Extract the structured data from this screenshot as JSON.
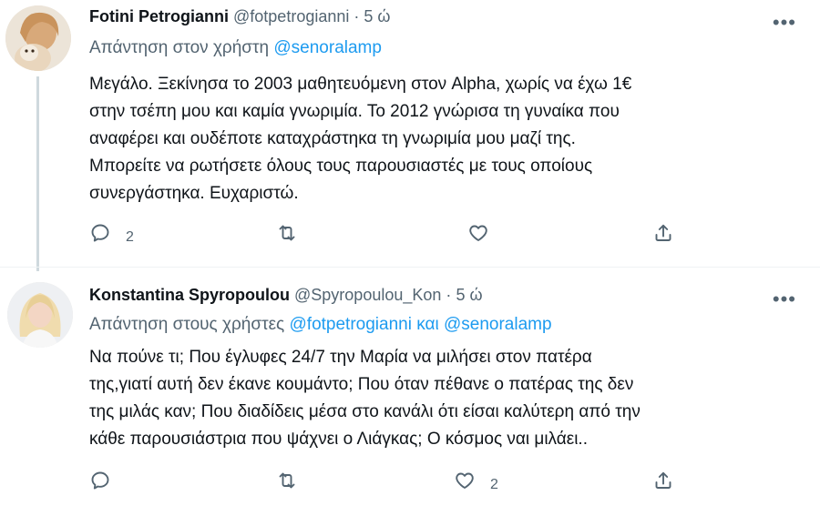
{
  "tweets": [
    {
      "name": "Fotini Petrogianni",
      "handle": "@fotpetrogianni",
      "dot": "·",
      "time": "5 ώ",
      "reply_prefix": "Απάντηση στον χρήστη",
      "mentions": [
        "@senoralamp"
      ],
      "mention_joiner": "",
      "body_lines": [
        "Μεγάλο. Ξεκίνησα το 2003 μαθητευόμενη στον Alpha, χωρίς να έχω 1€",
        "στην τσέπη μου και καμία γνωριμία. Το 2012 γνώρισα τη γυναίκα που",
        "αναφέρει και ουδέποτε καταχράστηκα τη γνωριμία μου μαζί της.",
        "Μπορείτε να ρωτήσετε όλους τους παρουσιαστές με τους οποίους",
        "συνεργάστηκα. Ευχαριστώ."
      ],
      "reply_count": "2",
      "retweet_count": "",
      "like_count": "",
      "more_icon": "more-icon"
    },
    {
      "name": "Konstantina Spyropoulou",
      "handle": "@Spyropoulou_Kon",
      "dot": "·",
      "time": "5 ώ",
      "reply_prefix": "Απάντηση στους χρήστες",
      "mentions": [
        "@fotpetrogianni",
        "@senoralamp"
      ],
      "mention_joiner": "και",
      "body_lines": [
        "Να πούνε τι; Που έγλυφες 24/7 την Μαρία να μιλήσει στον πατέρα",
        "της,γιατί αυτή δεν έκανε κουμάντο; Που όταν πέθανε ο πατέρας της δεν",
        "της μιλάς καν; Που διαδίδεις μέσα στο κανάλι ότι είσαι καλύτερη από την",
        "κάθε παρουσιάστρια που ψάχνει ο Λιάγκας; Ο κόσμος ναι μιλάει.."
      ],
      "reply_count": "",
      "retweet_count": "",
      "like_count": "2",
      "more_icon": "more-icon"
    }
  ],
  "colors": {
    "accent": "#1d9bf0",
    "secondary_text": "#536471",
    "primary_text": "#0f1419",
    "thread_line": "#cfd9de"
  },
  "icons": [
    "reply-icon",
    "retweet-icon",
    "like-icon",
    "share-icon",
    "more-icon"
  ]
}
